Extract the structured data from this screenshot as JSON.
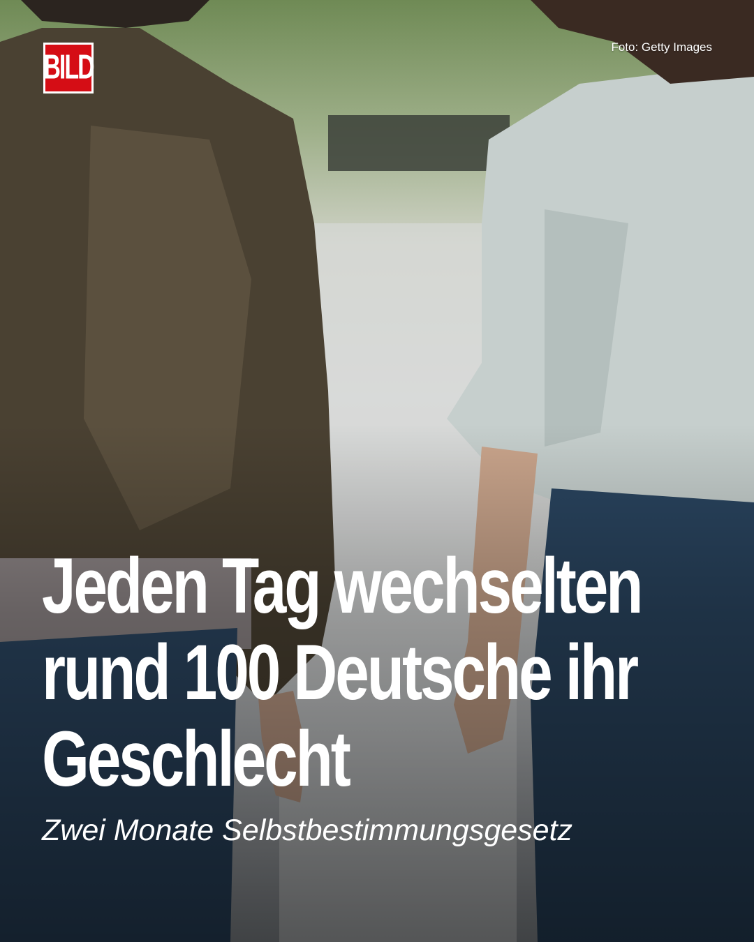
{
  "brand": {
    "logo_text": "BILD"
  },
  "photo": {
    "credit": "Foto: Getty Images",
    "colors": {
      "jacket": "#4a4132",
      "shirt": "#c7d0cf",
      "jeans": "#2a4560",
      "skin": "#caa58c",
      "background_trees": "#6f8a55"
    }
  },
  "headline": {
    "lines": [
      "Jeden Tag wechselten",
      "rund 100 Deutsche ihr",
      "Geschlecht"
    ]
  },
  "subline": "Zwei Monate Selbstbestimmungsgesetz",
  "colors": {
    "brand_red": "#d50d15",
    "text": "#ffffff"
  }
}
